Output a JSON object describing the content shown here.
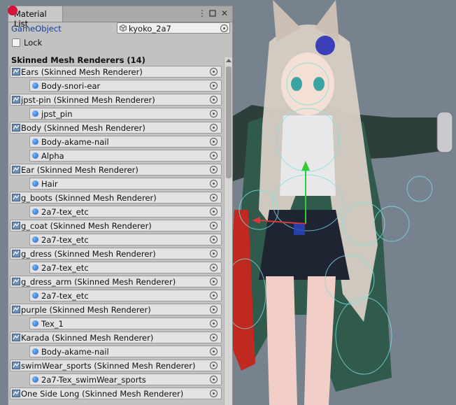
{
  "panel": {
    "tab_title": "Material List",
    "menu_icon": "kebab-menu-icon",
    "close_icon": "close-icon",
    "gameobject_label": "GameObject",
    "gameobject_value": "kyoko_2a7",
    "lock_label": "Lock",
    "section_header": "Skinned Mesh Renderers (14)"
  },
  "renderers": [
    {
      "name": "Ears (Skinned Mesh Renderer)",
      "materials": [
        "Body-snori-ear"
      ]
    },
    {
      "name": "jpst-pin (Skinned Mesh Renderer)",
      "materials": [
        "jpst_pin"
      ]
    },
    {
      "name": "Body (Skinned Mesh Renderer)",
      "materials": [
        "Body-akame-nail",
        "Alpha"
      ]
    },
    {
      "name": "Ear (Skinned Mesh Renderer)",
      "materials": [
        "Hair"
      ]
    },
    {
      "name": "g_boots (Skinned Mesh Renderer)",
      "materials": [
        "2a7-tex_etc"
      ]
    },
    {
      "name": "g_coat (Skinned Mesh Renderer)",
      "materials": [
        "2a7-tex_etc"
      ]
    },
    {
      "name": "g_dress (Skinned Mesh Renderer)",
      "materials": [
        "2a7-tex_etc"
      ]
    },
    {
      "name": "g_dress_arm (Skinned Mesh Renderer)",
      "materials": [
        "2a7-tex_etc"
      ]
    },
    {
      "name": "purple (Skinned Mesh Renderer)",
      "materials": [
        "Tex_1"
      ]
    },
    {
      "name": "Karada (Skinned Mesh Renderer)",
      "materials": [
        "Body-akame-nail"
      ]
    },
    {
      "name": "swimWear_sports (Skinned Mesh Renderer)",
      "materials": [
        "2a7-Tex_swimWear_sports"
      ]
    },
    {
      "name": "One Side Long (Skinned Mesh Renderer)",
      "materials": []
    }
  ],
  "colors": {
    "accent_link": "#0f3f9c",
    "tab_dot": "#d2143a",
    "material_icon": "#1b5fc8",
    "coat_green": "#2f5a4c",
    "hair": "#d8cfc4",
    "skirt": "#1f2433",
    "gizmo_cyan": "#7fe0e0"
  }
}
